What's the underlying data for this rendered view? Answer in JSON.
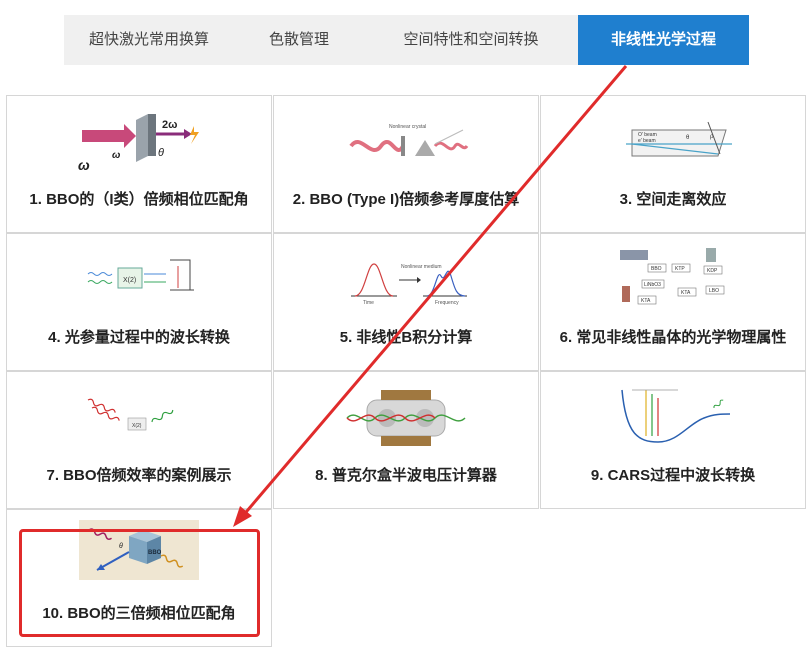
{
  "tabs": [
    {
      "label": "超快激光常用换算"
    },
    {
      "label": "色散管理"
    },
    {
      "label": "空间特性和空间转换"
    },
    {
      "label": "非线性光学过程",
      "active": true
    }
  ],
  "cards": [
    {
      "title": "1. BBO的（I类）倍频相位匹配角",
      "thumb_labels": [
        "ω",
        "ω",
        "2ω",
        "θ"
      ]
    },
    {
      "title": "2. BBO (Type I)倍频参考厚度估算",
      "thumb_labels": [
        "Nonlinear crystal"
      ]
    },
    {
      "title": "3. 空间走离效应",
      "thumb_labels": [
        "O' beam",
        "e' beam",
        "θ",
        "ρ"
      ]
    },
    {
      "title": "4. 光参量过程中的波长转换",
      "thumb_labels": [
        "X(2)"
      ]
    },
    {
      "title": "5. 非线性B积分计算",
      "thumb_labels": [
        "Time",
        "Nonlinear medium",
        "Frequency"
      ]
    },
    {
      "title": "6. 常见非线性晶体的光学物理属性",
      "thumb_labels": [
        "BBO",
        "KTP",
        "KDP",
        "LiNbO3",
        "KTA",
        "LBO",
        "KTA"
      ]
    },
    {
      "title": "7. BBO倍频效率的案例展示",
      "thumb_labels": [
        "X(2)"
      ]
    },
    {
      "title": "8. 普克尔盒半波电压计算器",
      "thumb_labels": []
    },
    {
      "title": "9. CARS过程中波长转换",
      "thumb_labels": []
    },
    {
      "title": "10. BBO的三倍频相位匹配角",
      "thumb_labels": [
        "BBO",
        "θ"
      ]
    }
  ],
  "colors": {
    "accent": "#1f7fcf",
    "highlight": "#e02b2b"
  }
}
